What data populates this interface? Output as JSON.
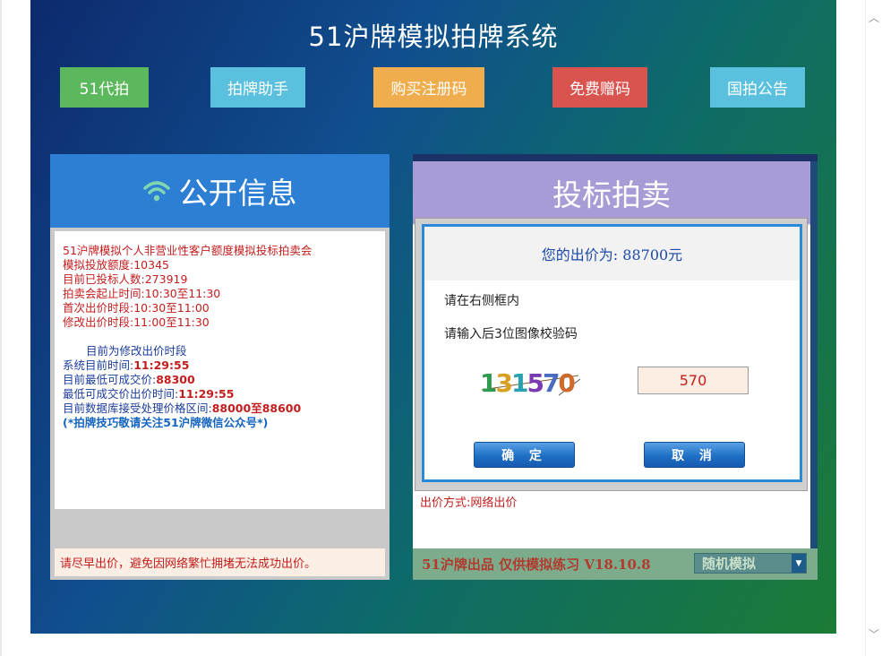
{
  "title": "51沪牌模拟拍牌系统",
  "nav": [
    {
      "label": "51代拍",
      "color": "#5cb85c"
    },
    {
      "label": "拍牌助手",
      "color": "#5bc0de"
    },
    {
      "label": "购买注册码",
      "color": "#f0ad4e"
    },
    {
      "label": "免费赠码",
      "color": "#d9534f"
    },
    {
      "label": "国拍公告",
      "color": "#5bc0de"
    }
  ],
  "left_panel": {
    "header": "公开信息",
    "icon": "wifi-icon",
    "lines": [
      "51沪牌模拟个人非营业性客户额度模拟投标拍卖会",
      "模拟投放额度:10345",
      "目前已投标人数:273919",
      "拍卖会起止时间:10:30至11:30",
      "首次出价时段:10:30至11:00",
      "修改出价时段:11:00至11:30"
    ],
    "status_heading": "目前为修改出价时段",
    "system_time_label": "系统目前时间:",
    "system_time": "11:29:55",
    "min_price_label": "目前最低可成交价:",
    "min_price": "88300",
    "min_price_time_label": "最低可成交价出价时间:",
    "min_price_time": "11:29:55",
    "range_label": "目前数据库接受处理价格区间:",
    "range": "88000至88600",
    "tip": "(*拍牌技巧敬请关注51沪牌微信公众号*)",
    "footer": "请尽早出价，避免因网络繁忙拥堵无法成功出价。"
  },
  "right_panel": {
    "header": "投标拍卖",
    "bid_method": "出价方式:网络出价",
    "footer_text": "51沪牌出品  仅供模拟练习  V18.10.8",
    "mode_value": "随机模拟"
  },
  "dialog": {
    "bid_text": "您的出价为: 88700元",
    "instruction1": "请在右侧框内",
    "instruction2": "请输入后3位图像校验码",
    "captcha": "131570",
    "captcha_input": "570",
    "confirm": "确 定",
    "cancel": "取 消"
  }
}
